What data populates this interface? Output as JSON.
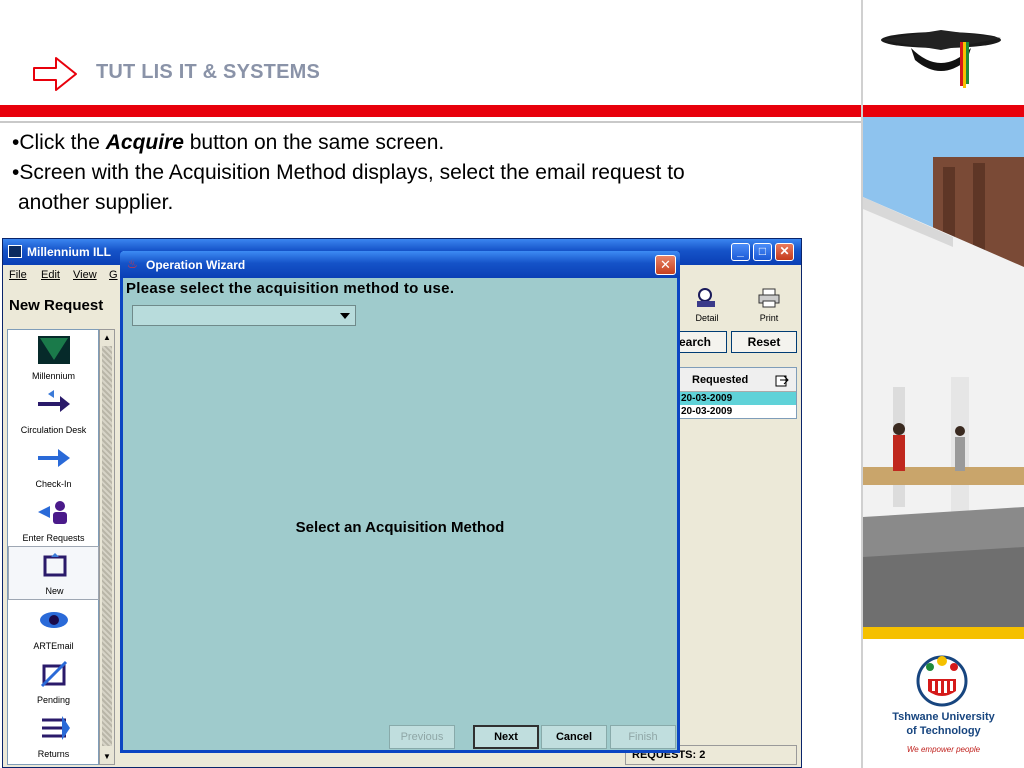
{
  "slide": {
    "title": "TUT LIS IT & SYSTEMS",
    "bullets": [
      {
        "prefix": "•Click the ",
        "emphasis": "Acquire",
        "suffix": " button on the same screen."
      },
      {
        "text": "•Screen with the Acquisition Method displays, select the email request to"
      },
      {
        "text": " another supplier."
      }
    ]
  },
  "sidebar": {
    "university_name_line1": "Tshwane University",
    "university_name_line2": "of Technology",
    "tagline": "We empower people"
  },
  "millennium": {
    "window_title": "Millennium ILL",
    "menu": [
      "File",
      "Edit",
      "View",
      "G"
    ],
    "heading": "New Request",
    "nav_items": [
      {
        "label": "Millennium",
        "icon": "millennium-logo-icon"
      },
      {
        "label": "Circulation Desk",
        "icon": "circulation-arrows-icon"
      },
      {
        "label": "Check-In",
        "icon": "check-in-arrow-icon"
      },
      {
        "label": "Enter Requests",
        "icon": "enter-requests-person-icon"
      },
      {
        "label": "New",
        "icon": "new-document-icon"
      },
      {
        "label": "ARTEmail",
        "icon": "artemail-icon"
      },
      {
        "label": "Pending",
        "icon": "pending-icon"
      },
      {
        "label": "Returns",
        "icon": "returns-icon"
      }
    ],
    "toolbar": {
      "detail_label": "Detail",
      "print_label": "Print"
    },
    "search_label": "earch",
    "reset_label": "Reset",
    "table": {
      "header": "Requested",
      "rows": [
        "20-03-2009",
        "20-03-2009"
      ]
    },
    "status": "REQUESTS: 2"
  },
  "wizard": {
    "title": "Operation Wizard",
    "prompt": "Please select the acquisition method to use.",
    "select_value": "",
    "center_message": "Select an Acquisition Method",
    "buttons": {
      "previous": "Previous",
      "next": "Next",
      "cancel": "Cancel",
      "finish": "Finish"
    }
  },
  "colors": {
    "accent_red": "#e8000b",
    "wizard_bg": "#9fcbcc",
    "xp_blue": "#1553c8",
    "brand_yellow": "#f5c000"
  }
}
